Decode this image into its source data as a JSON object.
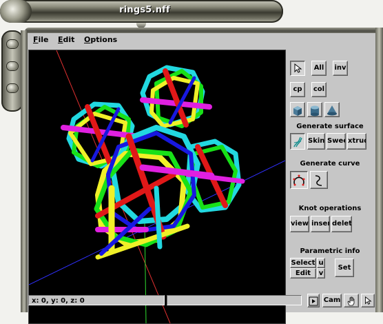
{
  "window": {
    "title": "rings5.nff"
  },
  "menu": {
    "file": "File",
    "file_key": "F",
    "file_rest": "ile",
    "edit": "Edit",
    "edit_key": "E",
    "edit_rest": "dit",
    "options": "Options",
    "options_key": "O",
    "options_rest": "ptions"
  },
  "panel": {
    "all_label": "All",
    "inv_label": "inv",
    "cp_label": "cp",
    "col_label": "col",
    "generate_surface": "Generate surface",
    "skin_label": "Skin",
    "sweep_label": "Sweep",
    "extrude_label": "xtrud",
    "generate_curve": "Generate curve",
    "knot_operations": "Knot operations",
    "view_label": "view",
    "insert_label": "insert",
    "delete_label": "delete",
    "parametric_info": "Parametric info",
    "select_label": "Select",
    "edit_label": "Edit",
    "u_label": "u",
    "v_label": "v",
    "set_label": "Set"
  },
  "status": {
    "coords": "x: 0, y: 0, z: 0",
    "cam_label": "Cam"
  },
  "icons": {
    "pointer": "arrow-pointer-icon",
    "cube": "cube-icon",
    "cylinder": "cylinder-icon",
    "cone": "cone-icon",
    "surface": "surface-icon",
    "circle_curve": "circle-curve-icon",
    "freehand_curve": "freehand-curve-icon",
    "play": "play-icon",
    "hand": "hand-icon"
  },
  "colors": {
    "ring_cyan": "#22d8e0",
    "ring_green": "#18e018",
    "ring_yellow": "#f0f028",
    "ring_red": "#e01818",
    "ring_blue": "#1818e0",
    "ring_magenta": "#e020e0",
    "axis_red": "#e03030",
    "axis_blue": "#3030ff",
    "axis_green": "#30e030"
  }
}
